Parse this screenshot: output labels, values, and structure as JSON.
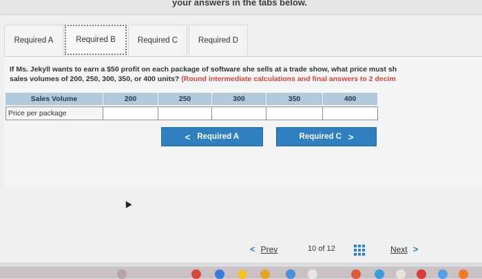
{
  "instruction": {
    "text": "your answers in the tabs below."
  },
  "tabs": [
    {
      "label": "Required A"
    },
    {
      "label": "Required B"
    },
    {
      "label": "Required C"
    },
    {
      "label": "Required D"
    }
  ],
  "active_tab": "Required B",
  "question": {
    "line1": "If Ms. Jekyll wants to earn a $50 profit on each package of software she sells at a trade show, what price must sh",
    "line2_main": "sales volumes of 200, 250, 300, 350, or 400 units?",
    "line2_note": "(Round intermediate calculations and final answers to 2 decim"
  },
  "table": {
    "header_label": "Sales Volume",
    "volumes": [
      "200",
      "250",
      "300",
      "350",
      "400"
    ],
    "row_label": "Price per package",
    "values": [
      "",
      "",
      "",
      "",
      ""
    ]
  },
  "buttons": {
    "prev_required": "Required A",
    "next_required": "Required C"
  },
  "pagination": {
    "prev_label": "Prev",
    "next_label": "Next",
    "page_text": "10 of 12"
  },
  "colors": {
    "accent": "#2f7fc1",
    "header_fill": "#b4c7dc",
    "note": "#d0453a"
  }
}
